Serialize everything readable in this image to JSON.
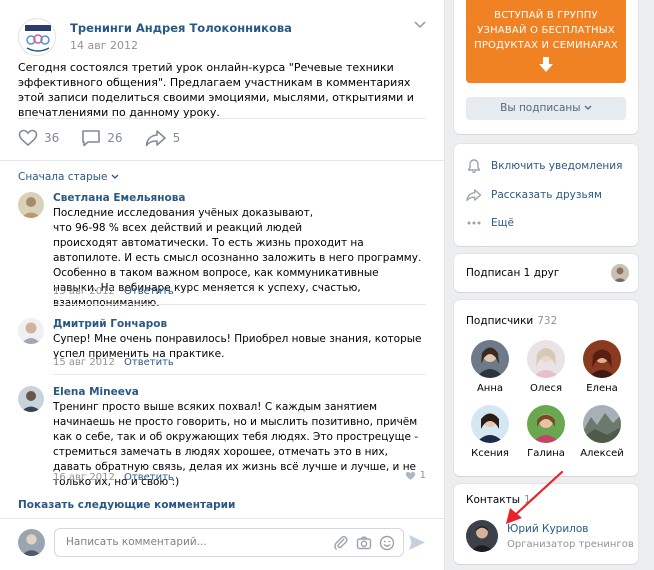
{
  "post": {
    "group_name": "Тренинги Андрея Толоконникова",
    "date": "14 авг 2012",
    "text": "Сегодня состоялся третий урок онлайн-курса \"Речевые техники эффективного общения\". Предлагаем участникам в комментариях этой записи поделиться своими эмоциями, мыслями, открытиями и впечатлениями по данному уроку.",
    "likes": "36",
    "comments": "26",
    "shares": "5"
  },
  "comments_block": {
    "sort_label": "Сначала старые",
    "items": [
      {
        "name": "Светлана Емельянова",
        "text": "Последние исследования учёных доказывают,\nчто 96-98 % всех действий и реакций людей\nпроисходят автоматически. То есть жизнь проходит на автопилоте. И есть смысл осознанно заложить в него программу. Особенно в таком важном вопросе, как коммуникативные навыки. На вебинаре курс меняется к успеху, счастью, взаимопониманию.",
        "date": "15 авг 2012",
        "reply": "Ответить"
      },
      {
        "name": "Дмитрий Гончаров",
        "text": "Супер! Мне очень понравилось! Приобрел новые знания, которые успел применить на практике.",
        "date": "15 авг 2012",
        "reply": "Ответить"
      },
      {
        "name": "Elena Mineeva",
        "text": "Тренинг просто выше всяких похвал! С каждым занятием начинаешь не просто говорить, но и мыслить позитивно, причём как о себе, так и об окружающих тебя людях. Это прострецуще - стремиться замечать в людях хорошее, отмечать это в них, давать обратную связь, делая их жизнь всё лучше и лучше, и не только их, но и свою :)",
        "date": "16 авг 2012",
        "reply": "Ответить",
        "likes": "1"
      }
    ],
    "show_more": "Показать следующие комментарии",
    "input_placeholder": "Написать комментарий..."
  },
  "join_card": {
    "banner_lines": [
      "ВСТУПАЙ В ГРУППУ",
      "УЗНАВАЙ О БЕСПЛАТНЫХ",
      "ПРОДУКТАХ И СЕМИНАРАХ"
    ],
    "subscribed_label": "Вы подписаны"
  },
  "menu": {
    "notify": "Включить уведомления",
    "tell": "Рассказать друзьям",
    "more": "Ещё"
  },
  "friends": {
    "label": "Подписан 1 друг"
  },
  "subscribers": {
    "title": "Подписчики",
    "count": "732",
    "people": [
      "Анна",
      "Олеся",
      "Елена",
      "Ксения",
      "Галина",
      "Алексей"
    ]
  },
  "contacts": {
    "title": "Контакты",
    "count": "1",
    "name": "Юрий Курилов",
    "role": "Организатор тренингов"
  },
  "colors": {
    "link": "#2a5885",
    "banner": "#f08223",
    "arrow": "#e8232a",
    "background": "#edeef0"
  }
}
